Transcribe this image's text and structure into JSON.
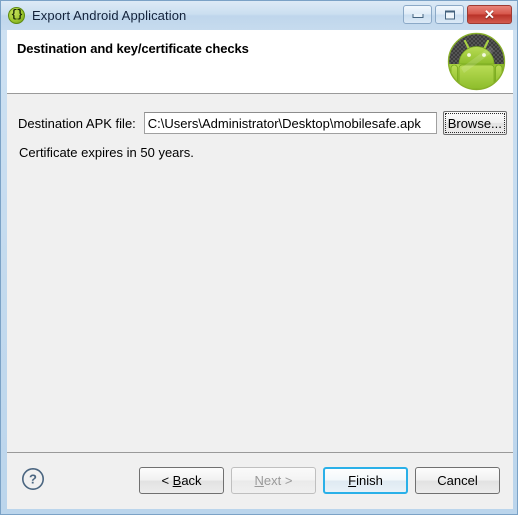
{
  "window": {
    "title": "Export Android Application",
    "title_icon": "braces-circle-icon",
    "controls": {
      "minimize": "minimize-icon",
      "maximize": "maximize-icon",
      "close": "close-icon",
      "close_glyph": "✕"
    },
    "accent_color": "#2ab0e8",
    "titlebar_color": "#c6dbee",
    "body_color": "#f0f0f0"
  },
  "header": {
    "title": "Destination and key/certificate checks",
    "logo": "android-robot-logo"
  },
  "form": {
    "apk_label": "Destination APK file:",
    "apk_value": "C:\\Users\\Administrator\\Desktop\\mobilesafe.apk",
    "apk_placeholder": "",
    "browse_label": "Browse...",
    "certificate_note": "Certificate expires in 50 years."
  },
  "footer": {
    "help": "?",
    "buttons": [
      {
        "id": "back",
        "label": "< Back",
        "mnemonic": "B",
        "state": "enabled"
      },
      {
        "id": "next",
        "label": "Next >",
        "mnemonic": "N",
        "state": "disabled"
      },
      {
        "id": "finish",
        "label": "Finish",
        "mnemonic": "F",
        "state": "default"
      },
      {
        "id": "cancel",
        "label": "Cancel",
        "mnemonic": "",
        "state": "enabled"
      }
    ],
    "back_pre": "< ",
    "back_mn": "B",
    "back_post": "ack",
    "next_mn": "N",
    "next_post": "ext >",
    "finish_mn": "F",
    "finish_post": "inish",
    "cancel_label": "Cancel"
  }
}
